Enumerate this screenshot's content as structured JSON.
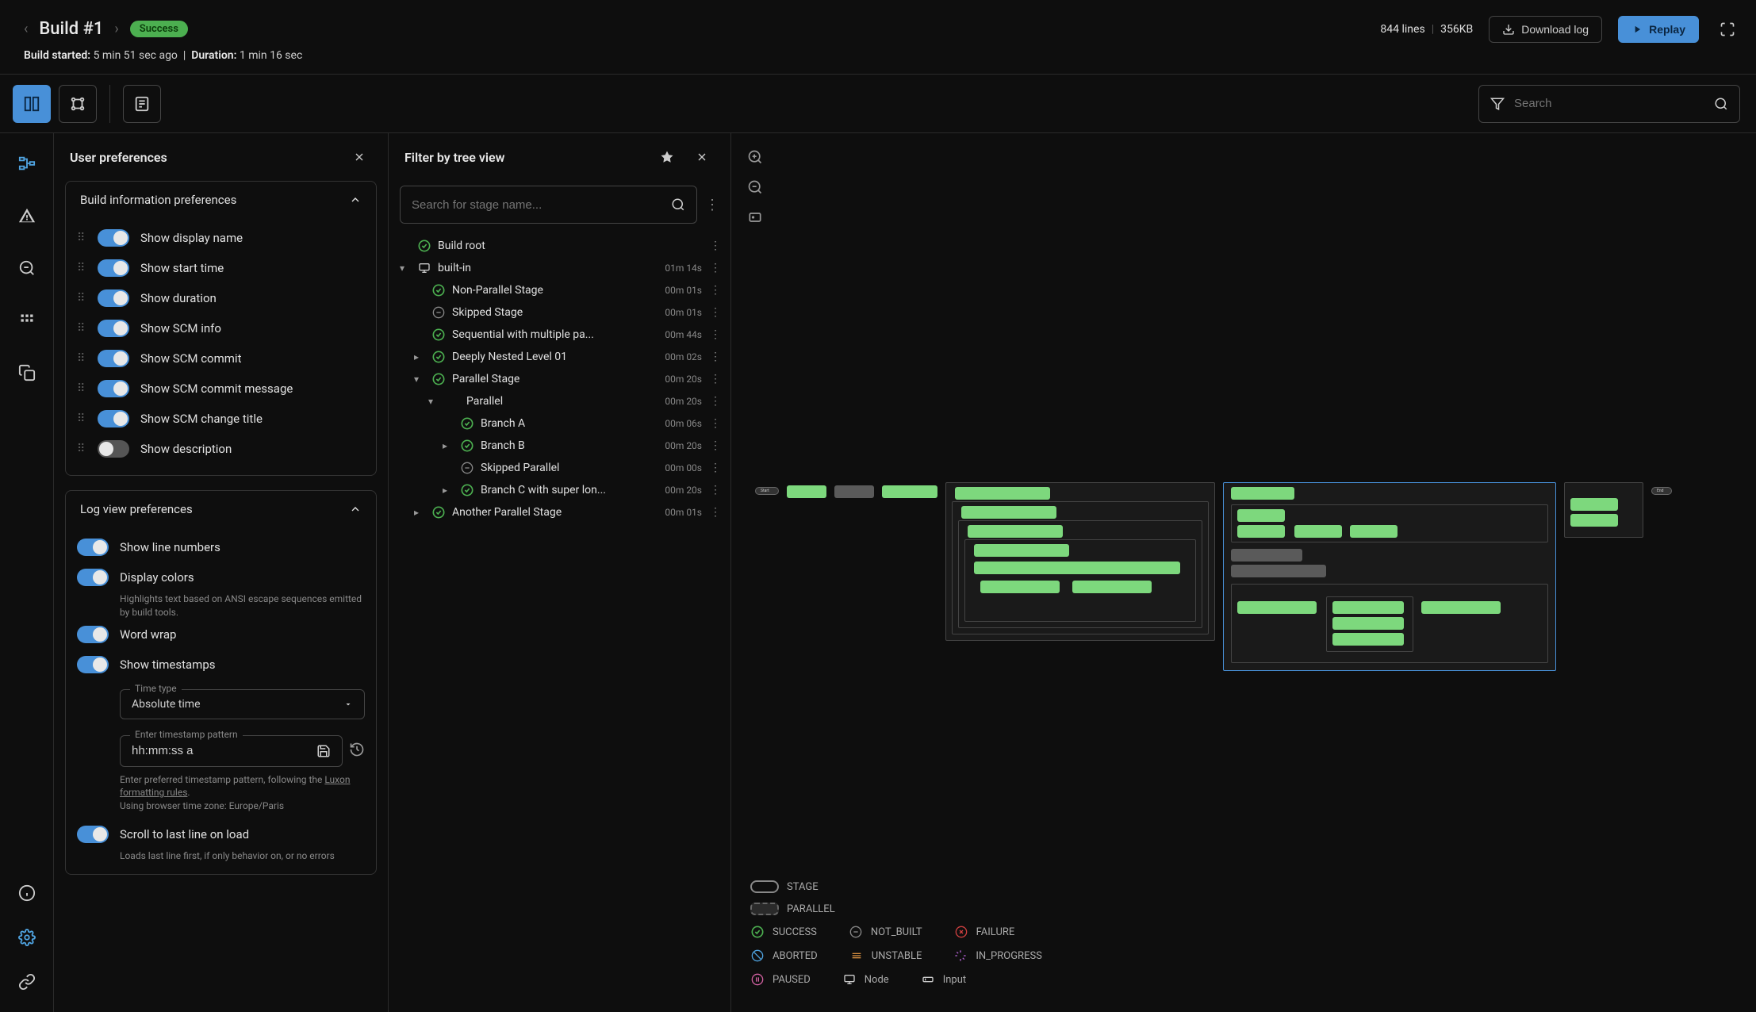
{
  "header": {
    "title": "Build #1",
    "status_badge": "Success",
    "stats_lines": "844 lines",
    "stats_size": "356KB",
    "download_label": "Download log",
    "replay_label": "Replay",
    "subheader_started_label": "Build started:",
    "subheader_started_value": "5 min 51 sec ago",
    "subheader_duration_label": "Duration:",
    "subheader_duration_value": "1 min 16 sec"
  },
  "search": {
    "placeholder": "Search"
  },
  "prefs_panel": {
    "title": "User preferences",
    "build_info_title": "Build information preferences",
    "build_items": [
      {
        "label": "Show display name",
        "on": true
      },
      {
        "label": "Show start time",
        "on": true
      },
      {
        "label": "Show duration",
        "on": true
      },
      {
        "label": "Show SCM info",
        "on": true
      },
      {
        "label": "Show SCM commit",
        "on": true
      },
      {
        "label": "Show SCM commit message",
        "on": true
      },
      {
        "label": "Show SCM change title",
        "on": true
      },
      {
        "label": "Show description",
        "on": false
      }
    ],
    "log_view_title": "Log view preferences",
    "log_items": {
      "line_numbers": "Show line numbers",
      "display_colors": "Display colors",
      "display_colors_help": "Highlights text based on ANSI escape sequences emitted by build tools.",
      "word_wrap": "Word wrap",
      "show_timestamps": "Show timestamps",
      "time_type_label": "Time type",
      "time_type_value": "Absolute time",
      "pattern_label": "Enter timestamp pattern",
      "pattern_value": "hh:mm:ss a",
      "pattern_help1": "Enter preferred timestamp pattern, following the ",
      "pattern_help_link": "Luxon formatting rules",
      "pattern_help2": ".",
      "tz_help": "Using browser time zone: Europe/Paris",
      "scroll_last": "Scroll to last line on load",
      "scroll_last_help": "Loads last line first, if only behavior on, or no errors"
    }
  },
  "tree_panel": {
    "title": "Filter by tree view",
    "search_placeholder": "Search for stage name...",
    "items": [
      {
        "indent": 0,
        "chev": "",
        "icon": "success",
        "label": "Build root",
        "time": ""
      },
      {
        "indent": 0,
        "chev": "down",
        "icon": "monitor",
        "label": "built-in",
        "time": "01m 14s"
      },
      {
        "indent": 1,
        "chev": "",
        "icon": "success",
        "label": "Non-Parallel Stage",
        "time": "00m 01s"
      },
      {
        "indent": 1,
        "chev": "",
        "icon": "notbuilt",
        "label": "Skipped Stage",
        "time": "00m 01s"
      },
      {
        "indent": 1,
        "chev": "",
        "icon": "success",
        "label": "Sequential with multiple pa...",
        "time": "00m 44s"
      },
      {
        "indent": 1,
        "chev": "right",
        "icon": "success",
        "label": "Deeply Nested Level 01",
        "time": "00m 02s"
      },
      {
        "indent": 1,
        "chev": "down",
        "icon": "success",
        "label": "Parallel Stage",
        "time": "00m 20s"
      },
      {
        "indent": 2,
        "chev": "down",
        "icon": "",
        "label": "Parallel",
        "time": "00m 20s"
      },
      {
        "indent": 3,
        "chev": "",
        "icon": "success",
        "label": "Branch A",
        "time": "00m 06s"
      },
      {
        "indent": 3,
        "chev": "right",
        "icon": "success",
        "label": "Branch B",
        "time": "00m 20s"
      },
      {
        "indent": 3,
        "chev": "",
        "icon": "notbuilt",
        "label": "Skipped Parallel",
        "time": "00m 00s"
      },
      {
        "indent": 3,
        "chev": "right",
        "icon": "success",
        "label": "Branch C with super lon...",
        "time": "00m 20s"
      },
      {
        "indent": 1,
        "chev": "right",
        "icon": "success",
        "label": "Another Parallel Stage",
        "time": "00m 01s"
      }
    ]
  },
  "legend": {
    "stage": "STAGE",
    "parallel": "PARALLEL",
    "success": "SUCCESS",
    "not_built": "NOT_BUILT",
    "failure": "FAILURE",
    "aborted": "ABORTED",
    "unstable": "UNSTABLE",
    "in_progress": "IN_PROGRESS",
    "paused": "PAUSED",
    "node": "Node",
    "input": "Input"
  }
}
